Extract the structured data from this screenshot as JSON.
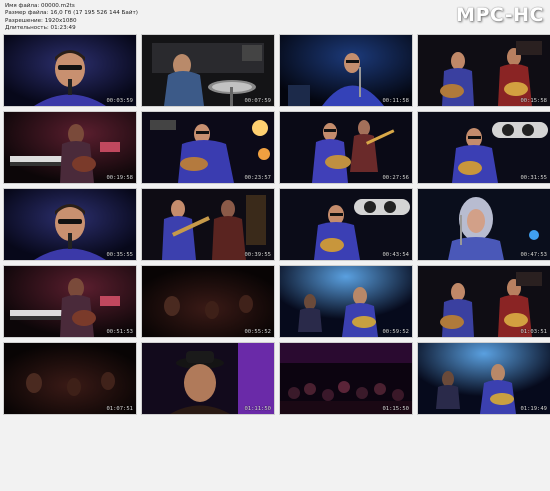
{
  "info": {
    "file_name": "Имя файла: 00000.m2ts",
    "file_size": "Размер файла: 16,0 Гб (17 195 526 144 Байт)",
    "resolution": "Разрешение: 1920x1080",
    "duration": "Длительность: 01:23:49"
  },
  "logo": "MPC-HC",
  "thumbnails": [
    {
      "timestamp": "00:03:59",
      "scene": "closeup-singer"
    },
    {
      "timestamp": "00:07:59",
      "scene": "drummer"
    },
    {
      "timestamp": "00:11:58",
      "scene": "singer-mic"
    },
    {
      "timestamp": "00:15:58",
      "scene": "two-guitarists"
    },
    {
      "timestamp": "00:19:58",
      "scene": "keyboards-guitar"
    },
    {
      "timestamp": "00:23:57",
      "scene": "guitarist-lights"
    },
    {
      "timestamp": "00:27:56",
      "scene": "guitarist-bass"
    },
    {
      "timestamp": "00:31:55",
      "scene": "guitarist-sign"
    },
    {
      "timestamp": "00:35:55",
      "scene": "closeup-singer"
    },
    {
      "timestamp": "00:39:55",
      "scene": "guitarist-duo"
    },
    {
      "timestamp": "00:43:54",
      "scene": "guitarist-sign"
    },
    {
      "timestamp": "00:47:53",
      "scene": "singer-grey-hair"
    },
    {
      "timestamp": "00:51:53",
      "scene": "keyboards-guitar"
    },
    {
      "timestamp": "00:55:52",
      "scene": "dark-stage"
    },
    {
      "timestamp": "00:59:52",
      "scene": "band-blue"
    },
    {
      "timestamp": "01:03:51",
      "scene": "two-guitarists"
    },
    {
      "timestamp": "01:07:51",
      "scene": "dark-stage"
    },
    {
      "timestamp": "01:11:50",
      "scene": "closeup-hat"
    },
    {
      "timestamp": "01:15:50",
      "scene": "crowd"
    },
    {
      "timestamp": "01:19:49",
      "scene": "band-blue"
    }
  ]
}
